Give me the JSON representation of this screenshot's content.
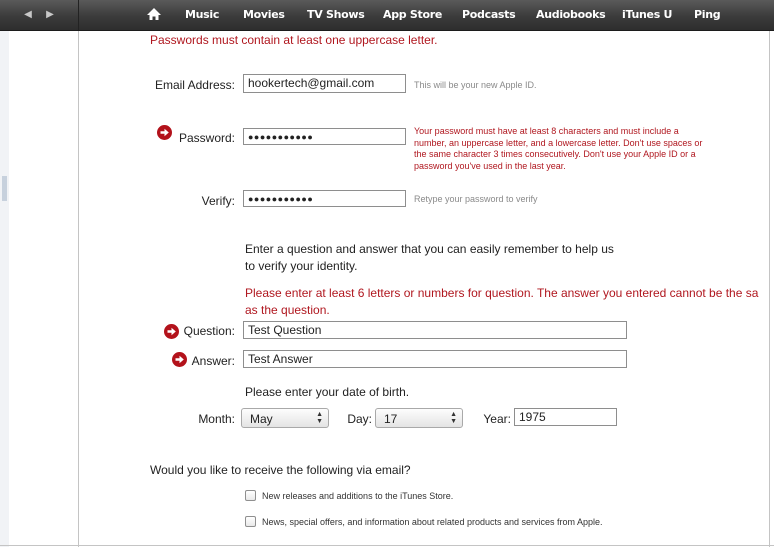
{
  "nav": {
    "back_icon": "left-triangle-icon",
    "forward_icon": "right-triangle-icon",
    "home_icon": "home-icon",
    "items": [
      "Music",
      "Movies",
      "TV Shows",
      "App Store",
      "Podcasts",
      "Audiobooks",
      "iTunes U",
      "Ping"
    ]
  },
  "form": {
    "top_error": "Passwords must contain at least one uppercase letter.",
    "email": {
      "label": "Email Address:",
      "value": "hookertech@gmail.com",
      "hint": "This will be your new Apple ID."
    },
    "password": {
      "label": "Password:",
      "value": "●●●●●●●●●●●",
      "error_lines": [
        "Your password must have at least 8 characters and must include a",
        "number, an uppercase letter, and a lowercase letter. Don't use spaces or",
        "the same character 3 times consecutively. Don't use your Apple ID or a",
        "password you've used in the last year."
      ]
    },
    "verify": {
      "label": "Verify:",
      "value": "●●●●●●●●●●●",
      "hint": "Retype your password to verify"
    },
    "security_intro_lines": [
      "Enter a question and answer that you can easily remember to help us",
      "to verify your identity."
    ],
    "security_error_lines": [
      "Please enter at least 6 letters or numbers for question. The answer you entered cannot be the sa",
      "as the question."
    ],
    "question": {
      "label": "Question:",
      "value": "Test Question"
    },
    "answer": {
      "label": "Answer:",
      "value": "Test Answer"
    },
    "dob": {
      "prompt": "Please enter your date of birth.",
      "month_label": "Month:",
      "month_value": "May",
      "day_label": "Day:",
      "day_value": "17",
      "year_label": "Year:",
      "year_value": "1975"
    },
    "email_prefs": {
      "question": "Would you like to receive the following via email?",
      "options": [
        "New releases and additions to the iTunes Store.",
        "News, special offers, and information about related products and services from Apple."
      ]
    }
  },
  "colors": {
    "error_red": "#b0171f",
    "navbar": "#3b3b3b",
    "arrow_badge": "#b3121b"
  }
}
